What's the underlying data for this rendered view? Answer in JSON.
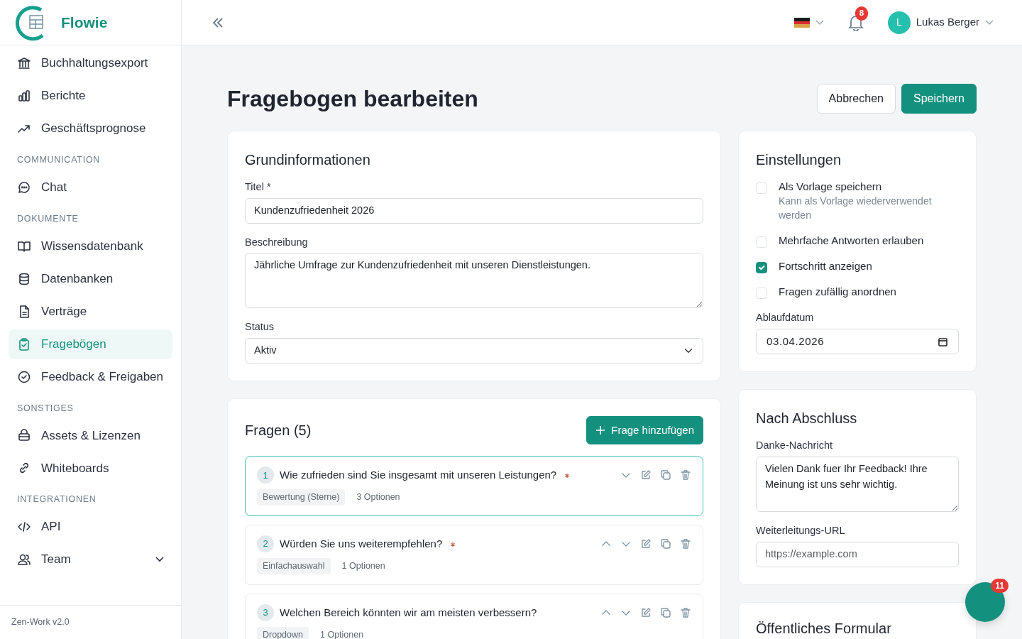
{
  "brand": {
    "name": "Flowie"
  },
  "sidebar": {
    "groups": [
      {
        "items": [
          {
            "label": "Buchhaltungsexport",
            "selected": false
          },
          {
            "label": "Berichte",
            "selected": false
          },
          {
            "label": "Geschäftsprognose",
            "selected": false
          }
        ]
      },
      {
        "heading": "COMMUNICATION",
        "items": [
          {
            "label": "Chat",
            "selected": false
          }
        ]
      },
      {
        "heading": "DOKUMENTE",
        "items": [
          {
            "label": "Wissensdatenbank",
            "selected": false
          },
          {
            "label": "Datenbanken",
            "selected": false
          },
          {
            "label": "Verträge",
            "selected": false
          },
          {
            "label": "Fragebögen",
            "selected": true
          },
          {
            "label": "Feedback & Freigaben",
            "selected": false
          }
        ]
      },
      {
        "heading": "SONSTIGES",
        "items": [
          {
            "label": "Assets & Lizenzen",
            "selected": false
          },
          {
            "label": "Whiteboards",
            "selected": false
          }
        ]
      },
      {
        "heading": "INTEGRATIONEN",
        "items": [
          {
            "label": "API",
            "selected": false
          },
          {
            "label": "Team",
            "selected": false,
            "expanded": false
          }
        ]
      }
    ],
    "version": "Zen-Work v2.0"
  },
  "header": {
    "notifications": "8",
    "user": {
      "initial": "L",
      "name": "Lukas Berger"
    }
  },
  "page": {
    "title": "Fragebogen bearbeiten",
    "cancel": "Abbrechen",
    "save": "Speichern"
  },
  "basic_info": {
    "heading": "Grundinformationen",
    "title_label": "Titel *",
    "title_value": "Kundenzufriedenheit 2026",
    "description_label": "Beschreibung",
    "description_value": "Jährliche Umfrage zur Kundenzufriedenheit mit unseren Dienstleistungen.",
    "status_label": "Status",
    "status_value": "Aktiv"
  },
  "questions": {
    "heading": "Fragen (5)",
    "add_button": "Frage hinzufügen",
    "items": [
      {
        "number": "1",
        "text": "Wie zufrieden sind Sie insgesamt mit unseren Leistungen?",
        "required": true,
        "type": "Bewertung (Sterne)",
        "options": "3 Optionen",
        "can_move_up": false,
        "can_move_down": true,
        "selected": true
      },
      {
        "number": "2",
        "text": "Würden Sie uns weiterempfehlen?",
        "required": true,
        "type": "Einfachauswahl",
        "options": "1 Optionen",
        "can_move_up": true,
        "can_move_down": true,
        "selected": false
      },
      {
        "number": "3",
        "text": "Welchen Bereich könnten wir am meisten verbessern?",
        "required": false,
        "type": "Dropdown",
        "options": "1 Optionen",
        "can_move_up": true,
        "can_move_down": true,
        "selected": false
      }
    ]
  },
  "settings": {
    "heading": "Einstellungen",
    "options": [
      {
        "label": "Als Vorlage speichern",
        "hint": "Kann als Vorlage wiederverwendet werden",
        "checked": false
      },
      {
        "label": "Mehrfache Antworten erlauben",
        "checked": false
      },
      {
        "label": "Fortschritt anzeigen",
        "checked": true
      },
      {
        "label": "Fragen zufällig anordnen",
        "checked": false
      }
    ],
    "expiry_label": "Ablaufdatum",
    "expiry_value": "03.04.2026"
  },
  "after_completion": {
    "heading": "Nach Abschluss",
    "thanks_label": "Danke-Nachricht",
    "thanks_value": "Vielen Dank fuer Ihr Feedback! Ihre Meinung ist uns sehr wichtig.",
    "redirect_label": "Weiterleitungs-URL",
    "redirect_placeholder": "https://example.com"
  },
  "public_form": {
    "heading": "Öffentliches Formular"
  },
  "chat_fab": {
    "badge": "11"
  }
}
